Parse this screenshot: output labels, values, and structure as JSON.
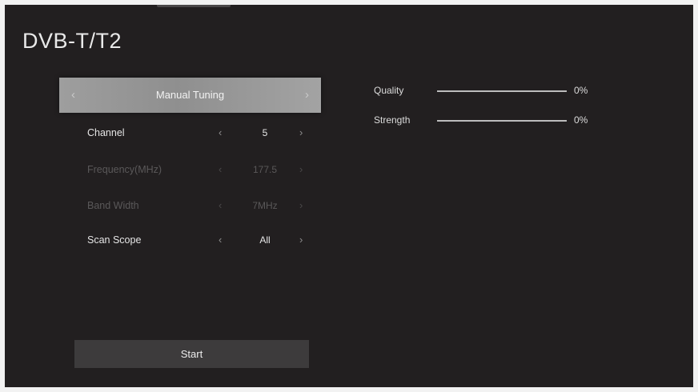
{
  "page": {
    "title": "DVB-T/T2"
  },
  "tuning_mode": {
    "label": "Manual Tuning",
    "left_arrow": "‹",
    "right_arrow": "›"
  },
  "settings": [
    {
      "label": "Channel",
      "value": "5",
      "enabled": true,
      "left_arrow": "‹",
      "right_arrow": "›"
    },
    {
      "label": "Frequency(MHz)",
      "value": "177.5",
      "enabled": false,
      "left_arrow": "‹",
      "right_arrow": "›"
    },
    {
      "label": "Band Width",
      "value": "7MHz",
      "enabled": false,
      "left_arrow": "‹",
      "right_arrow": "›"
    },
    {
      "label": "Scan Scope",
      "value": "All",
      "enabled": true,
      "left_arrow": "‹",
      "right_arrow": "›"
    }
  ],
  "signal": {
    "quality": {
      "label": "Quality",
      "value_text": "0%",
      "level": 0
    },
    "strength": {
      "label": "Strength",
      "value_text": "0%",
      "level": 0
    }
  },
  "start_button": {
    "label": "Start"
  },
  "colors": {
    "background": "#221f20",
    "highlight": "#9e9e9e",
    "button": "#3d3b3c",
    "text_enabled": "#e6e6e6",
    "text_disabled": "#5a5859"
  }
}
